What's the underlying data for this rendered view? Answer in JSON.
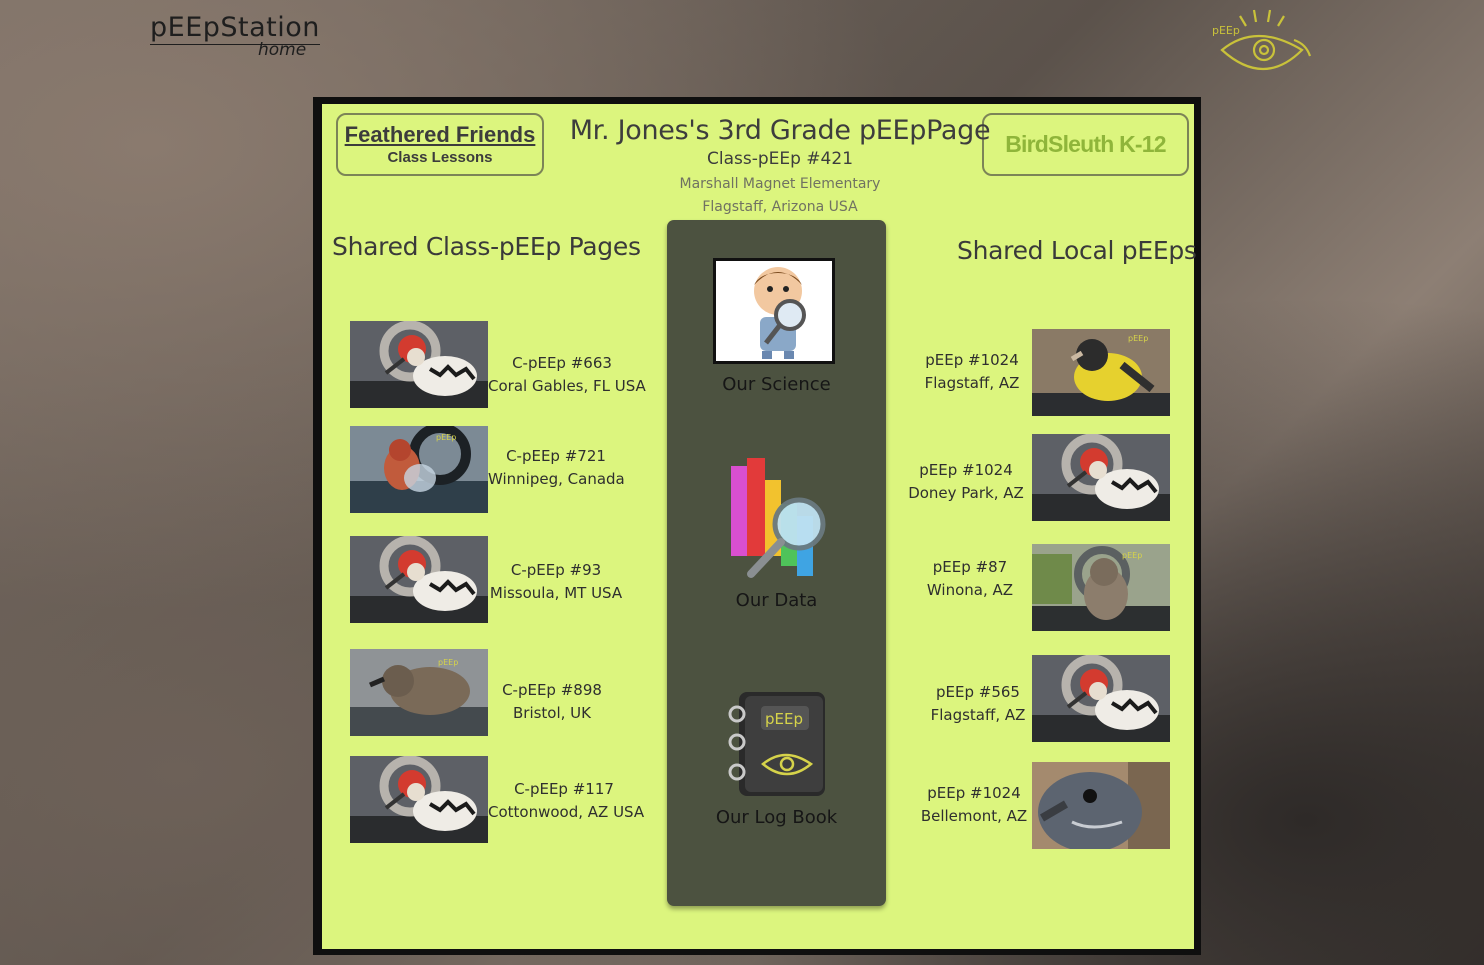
{
  "site": {
    "name": "pEEpStation",
    "home_label": "home",
    "logo_text": "pEEp"
  },
  "buttons": {
    "feathered_friends": {
      "title": "Feathered Friends",
      "subtitle": "Class Lessons"
    },
    "birdsleuth": {
      "label": "BirdSleuth K-12"
    }
  },
  "header": {
    "title": "Mr. Jones's 3rd Grade pEEpPage",
    "class_id": "Class-pEEp #421",
    "school": "Marshall Magnet Elementary",
    "location": "Flagstaff, Arizona USA"
  },
  "left_section": {
    "title": "Shared Class-pEEp Pages",
    "items": [
      {
        "id": "C-pEEp #663",
        "location": "Coral Gables, FL USA",
        "bird": "woodpecker"
      },
      {
        "id": "C-pEEp #721",
        "location": "Winnipeg, Canada",
        "bird": "finch"
      },
      {
        "id": "C-pEEp #93",
        "location": "Missoula, MT USA",
        "bird": "woodpecker"
      },
      {
        "id": "C-pEEp #898",
        "location": "Bristol, UK",
        "bird": "sparrow"
      },
      {
        "id": "C-pEEp #117",
        "location": "Cottonwood, AZ  USA",
        "bird": "woodpecker"
      }
    ]
  },
  "center": {
    "items": [
      {
        "label": "Our Science",
        "icon": "magnifier-boy-icon"
      },
      {
        "label": "Our Data",
        "icon": "bar-chart-magnifier-icon"
      },
      {
        "label": "Our Log Book",
        "icon": "log-book-icon",
        "book_text": "pEEp"
      }
    ]
  },
  "right_section": {
    "title": "Shared Local pEEps",
    "items": [
      {
        "id": "pEEp #1024",
        "location": "Flagstaff, AZ",
        "bird": "goldfinch"
      },
      {
        "id": "pEEp #1024",
        "location": "Doney Park, AZ",
        "bird": "woodpecker"
      },
      {
        "id": "pEEp #87",
        "location": "Winona, AZ",
        "bird": "sparrow"
      },
      {
        "id": "pEEp #565",
        "location": "Flagstaff, AZ",
        "bird": "woodpecker"
      },
      {
        "id": "pEEp #1024",
        "location": "Bellemont, AZ",
        "bird": "closeup"
      }
    ]
  }
}
